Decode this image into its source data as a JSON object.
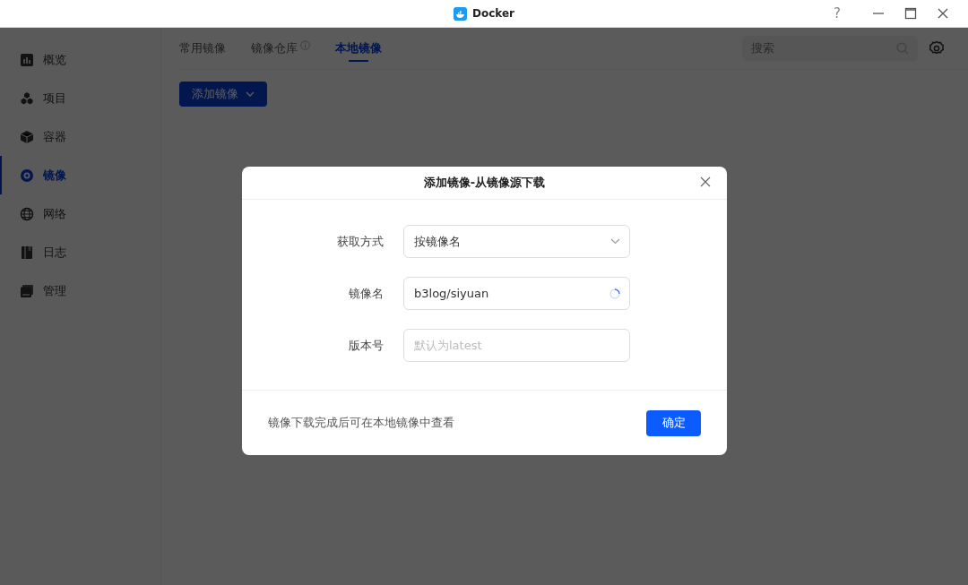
{
  "window": {
    "title": "Docker",
    "controls": [
      "?"
    ]
  },
  "sidebar": {
    "items": [
      {
        "label": "概览",
        "selected": false
      },
      {
        "label": "项目",
        "selected": false
      },
      {
        "label": "容器",
        "selected": false
      },
      {
        "label": "镜像",
        "selected": true
      },
      {
        "label": "网络",
        "selected": false
      },
      {
        "label": "日志",
        "selected": false
      },
      {
        "label": "管理",
        "selected": false
      }
    ]
  },
  "tabs": [
    {
      "label": "常用镜像",
      "selected": false,
      "info": false
    },
    {
      "label": "镜像仓库",
      "selected": false,
      "info": true
    },
    {
      "label": "本地镜像",
      "selected": true,
      "info": false
    }
  ],
  "search": {
    "placeholder": "搜索"
  },
  "add_button": {
    "label": "添加镜像"
  },
  "dialog": {
    "title": "添加镜像-从镜像源下载",
    "fields": [
      {
        "kind": "select",
        "label": "获取方式",
        "value": "按镜像名",
        "loading": false
      },
      {
        "kind": "input",
        "label": "镜像名",
        "value": "b3log/siyuan",
        "loading": true
      },
      {
        "kind": "input",
        "label": "版本号",
        "placeholder": "默认为latest",
        "loading": false
      }
    ],
    "note": "镜像下载完成后可在本地镜像中查看",
    "confirm": "确定"
  }
}
